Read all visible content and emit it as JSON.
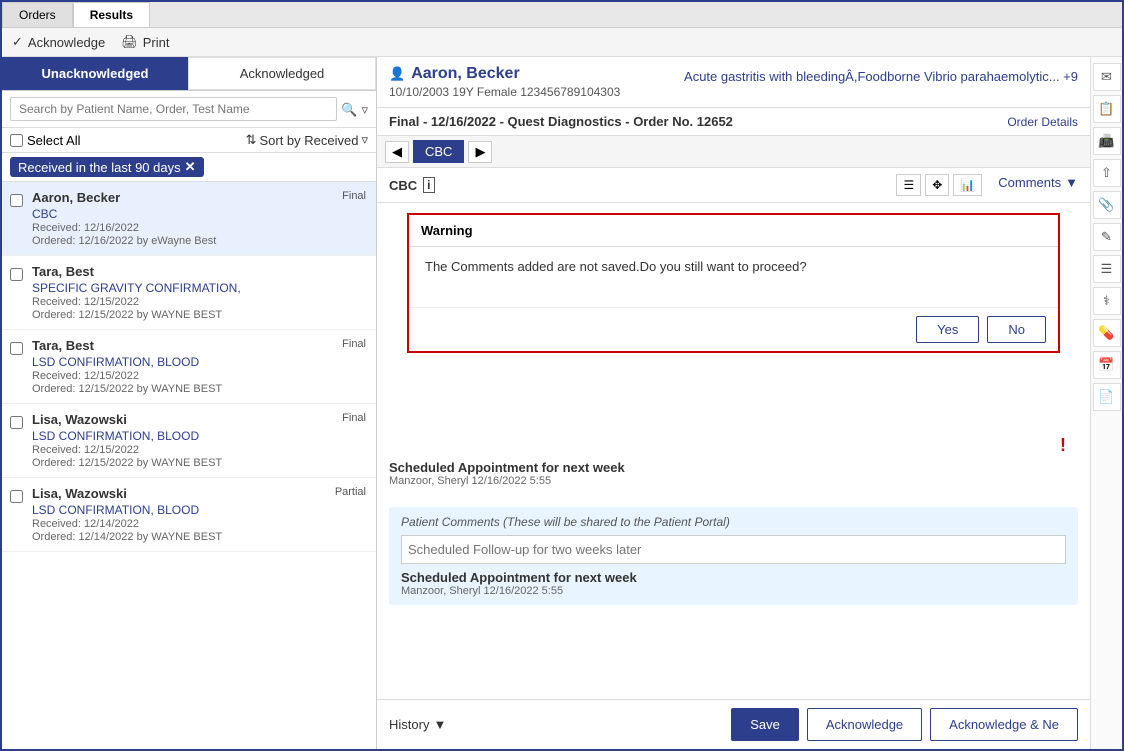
{
  "tabs": {
    "orders": "Orders",
    "results": "Results"
  },
  "toolbar": {
    "acknowledge_label": "Acknowledge",
    "print_label": "Print"
  },
  "status_tabs": {
    "unacknowledged": "Unacknowledged",
    "acknowledged": "Acknowledged"
  },
  "search": {
    "placeholder": "Search by Patient Name, Order, Test Name"
  },
  "list_controls": {
    "select_all": "Select All",
    "sort_label": "Sort by Received"
  },
  "filter": {
    "label": "Received in the last 90 days"
  },
  "patients": [
    {
      "name": "Aaron, Becker",
      "status": "Final",
      "test": "CBC",
      "received": "Received: 12/16/2022",
      "ordered": "Ordered: 12/16/2022 by eWayne Best"
    },
    {
      "name": "Tara, Best",
      "status": "",
      "test": "SPECIFIC GRAVITY CONFIRMATION,",
      "received": "Received: 12/15/2022",
      "ordered": "Ordered: 12/15/2022 by WAYNE BEST"
    },
    {
      "name": "Tara, Best",
      "status": "Final",
      "test": "LSD CONFIRMATION, BLOOD",
      "received": "Received: 12/15/2022",
      "ordered": "Ordered: 12/15/2022 by WAYNE BEST"
    },
    {
      "name": "Lisa, Wazowski",
      "status": "Final",
      "test": "LSD CONFIRMATION, BLOOD",
      "received": "Received: 12/15/2022",
      "ordered": "Ordered: 12/15/2022 by WAYNE BEST"
    },
    {
      "name": "Lisa, Wazowski",
      "status": "Partial",
      "test": "LSD CONFIRMATION, BLOOD",
      "received": "Received: 12/14/2022",
      "ordered": "Ordered: 12/14/2022 by WAYNE BEST"
    }
  ],
  "detail": {
    "patient_name": "Aaron, Becker",
    "dob_info": "10/10/2003  19Y  Female  123456789104303",
    "diagnoses": "Acute gastritis with bleedingÂ,Foodborne Vibrio parahaemolytic... +9",
    "order_info": "Final - 12/16/2022 - Quest Diagnostics - Order No. 12652",
    "order_details_link": "Order Details",
    "test_tab": "CBC",
    "cbc_title": "CBC",
    "comments_label": "Comments",
    "warning_title": "Warning",
    "warning_message": "The Comments added are not saved.Do you still want to proceed?",
    "yes_btn": "Yes",
    "no_btn": "No",
    "comment1_text": "Scheduled Appointment for next week",
    "comment1_author": "Manzoor, Sheryl  12/16/2022  5:55",
    "patient_comments_label": "Patient Comments (These will be shared to the Patient Portal)",
    "patient_comment_placeholder": "Scheduled Follow-up for two weeks later",
    "patient_comment2_text": "Scheduled Appointment for next week",
    "patient_comment2_author": "Manzoor, Sheryl  12/16/2022  5:55",
    "history_btn": "History",
    "save_btn": "Save",
    "acknowledge_btn": "Acknowledge",
    "acknowledge_next_btn": "Acknowledge & Ne"
  },
  "icons": {
    "acknowledge": "✓",
    "print": "🖨",
    "search": "🔍",
    "filter": "▽",
    "sort": "⇅",
    "person": "👤",
    "left_arrow": "◀",
    "right_arrow": "▶",
    "table_view": "☰",
    "grid_view": "⊞",
    "chart_view": "📊",
    "info": "ℹ",
    "email": "✉",
    "clipboard": "📋",
    "fax": "📠",
    "share": "⇧",
    "paperclip": "📎",
    "edit": "✏",
    "list": "☰",
    "stethoscope": "⚕",
    "pill": "💊",
    "calendar": "📅",
    "doc": "📄",
    "history_arrow": "▾",
    "comments_arrow": "▾"
  }
}
